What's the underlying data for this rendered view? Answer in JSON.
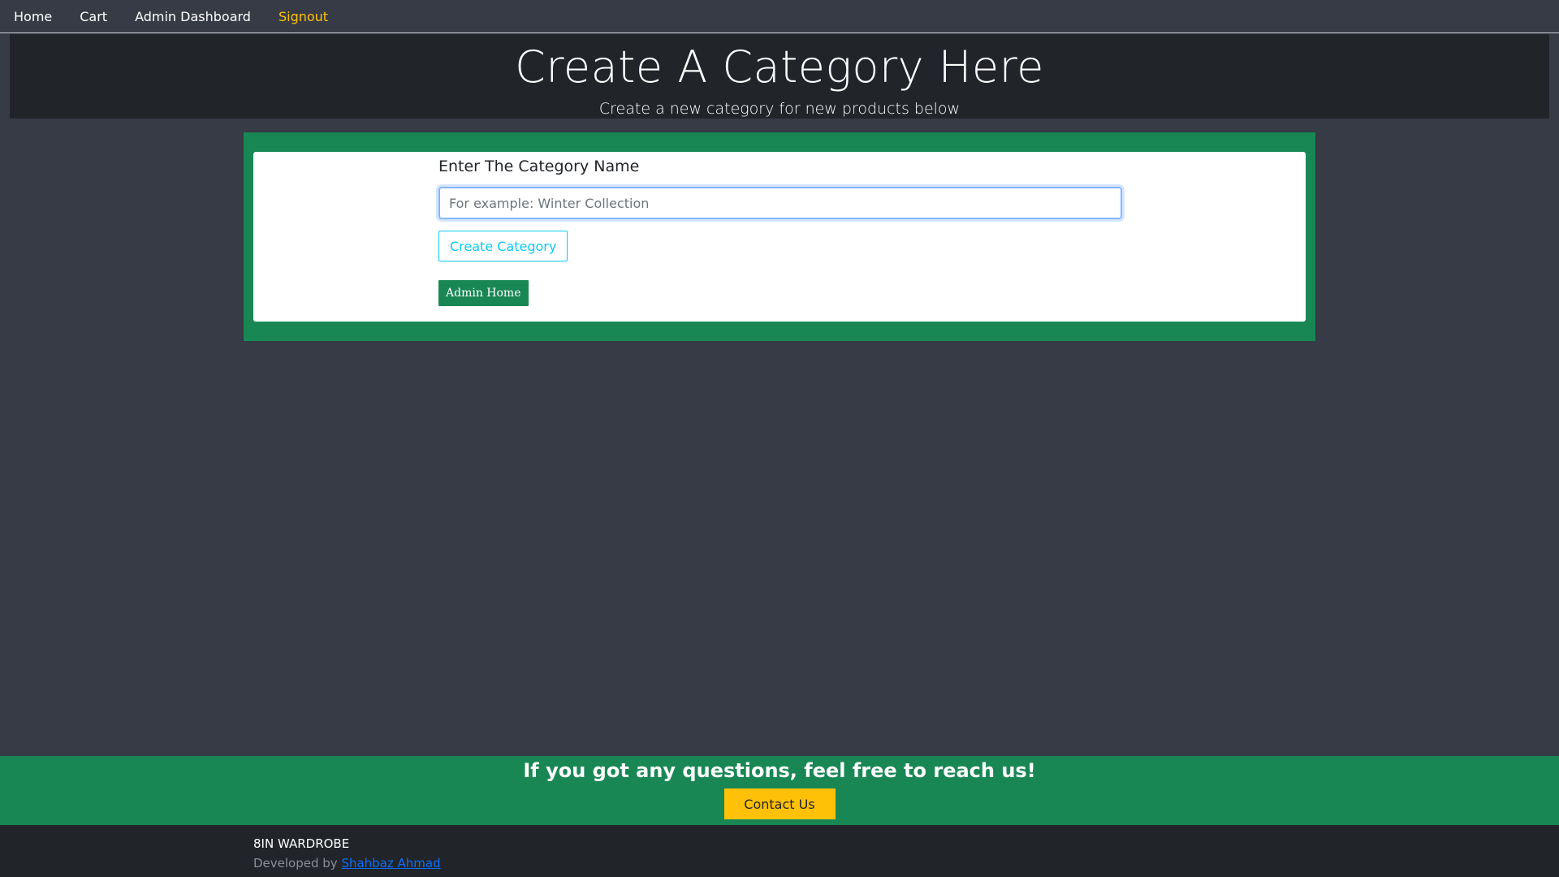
{
  "nav": {
    "home": "Home",
    "cart": "Cart",
    "admin_dashboard": "Admin Dashboard",
    "signout": "Signout"
  },
  "header": {
    "title": "Create A Category Here",
    "subtitle": "Create a new category for new products below"
  },
  "form": {
    "label": "Enter The Category Name",
    "input_value": "",
    "input_placeholder": "For example: Winter Collection",
    "create_button": "Create Category",
    "admin_home_button": "Admin Home"
  },
  "footer": {
    "cta_text": "If you got any questions, feel free to reach us!",
    "contact_button": "Contact Us",
    "brand": "8IN WARDROBE",
    "developed_by": "Developed by",
    "developer_name": "Shahbaz Ahmad"
  },
  "colors": {
    "background": "#363b45",
    "header_bg": "#212429",
    "green": "#198754",
    "yellow": "#ffc107",
    "info": "#0dcaf0",
    "link": "#0d6efd"
  }
}
